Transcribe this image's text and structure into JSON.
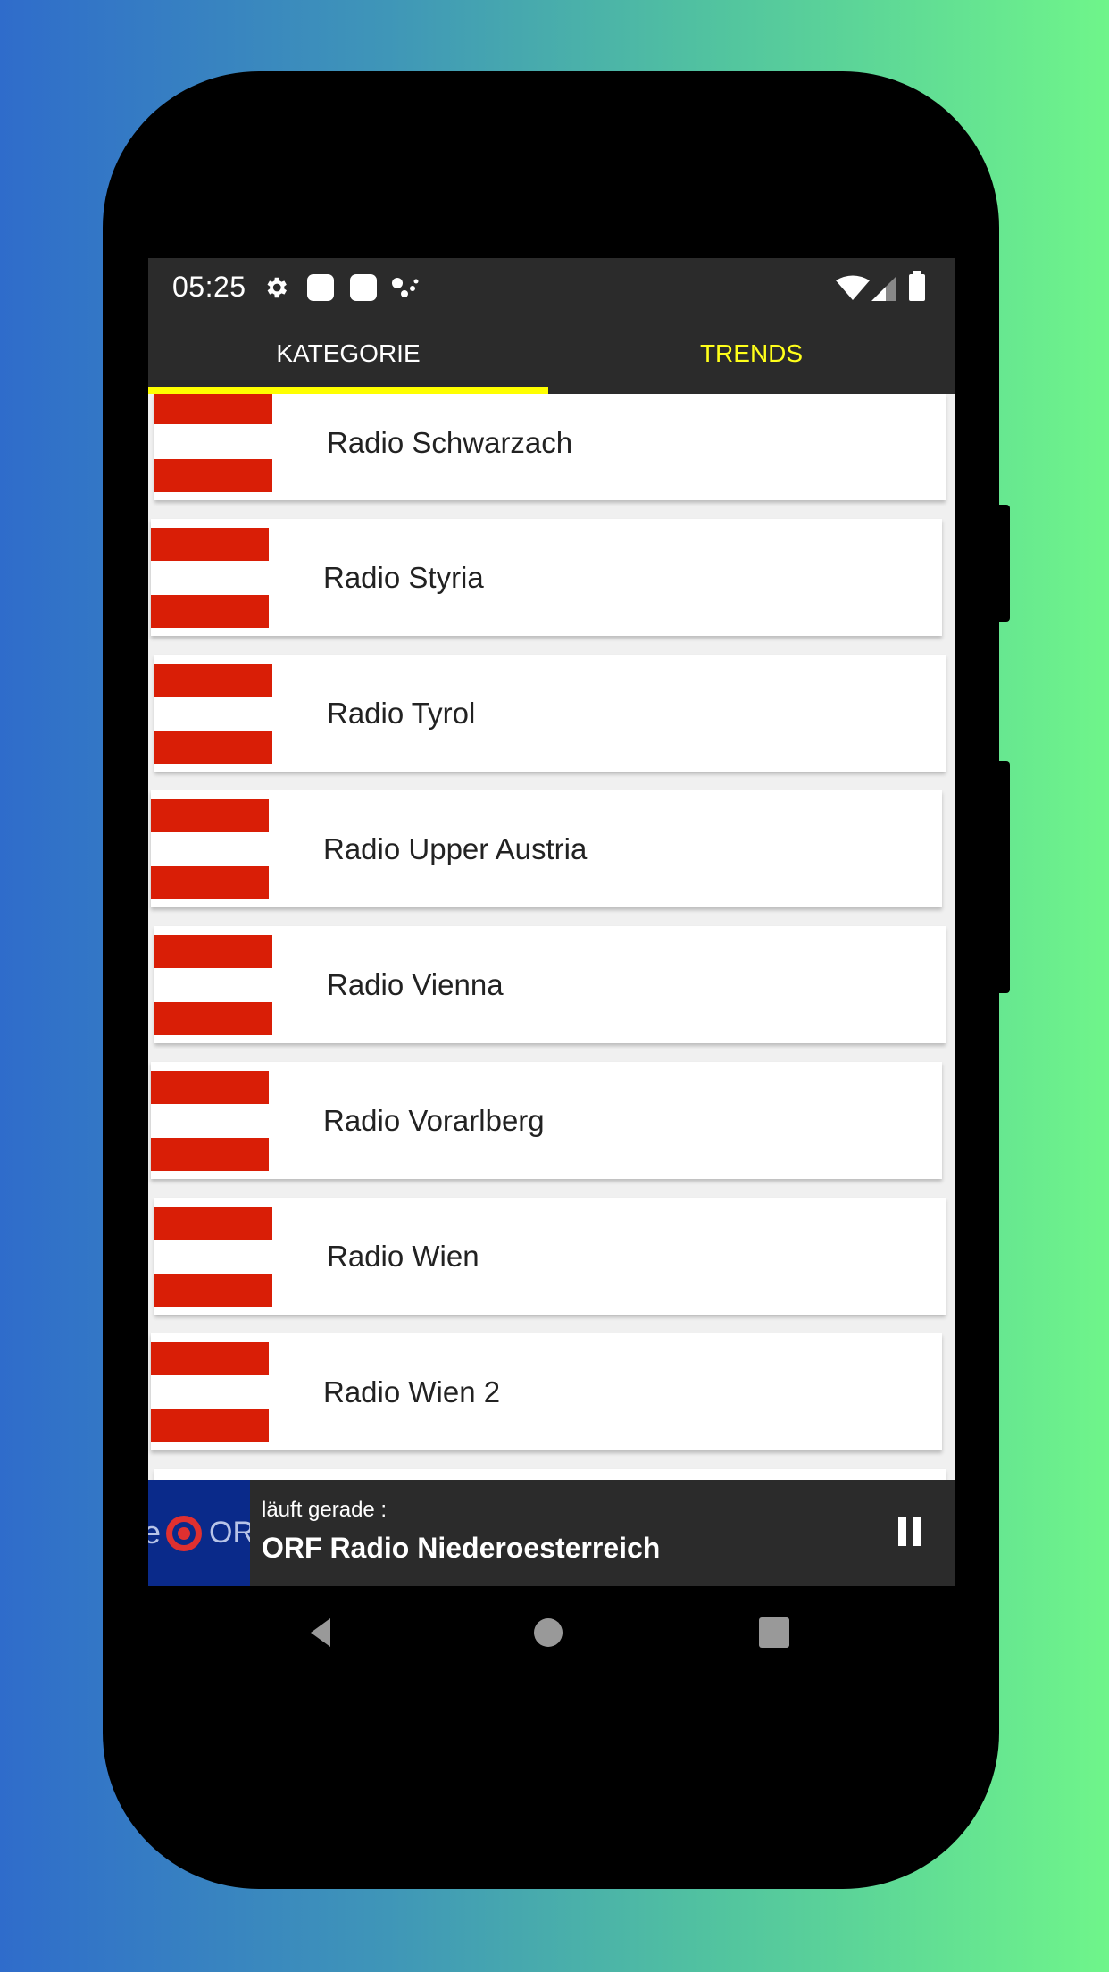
{
  "status_bar": {
    "time": "05:25",
    "left_icons": [
      "settings-gear-icon",
      "notification-app-icon",
      "notification-app-icon",
      "assistant-dots-icon"
    ],
    "right_icons": [
      "wifi-icon",
      "cellular-signal-icon",
      "battery-icon"
    ]
  },
  "tabs": [
    {
      "label": "KATEGORIE",
      "active": true
    },
    {
      "label": "TRENDS",
      "active": false
    }
  ],
  "colors": {
    "tab_indicator": "#ffff00",
    "trends_tab_text": "#ffff1a",
    "bar_background": "#2b2b2b",
    "flag_red": "#d91e06",
    "logo_blue": "#0a2a8a"
  },
  "stations": [
    {
      "name": "Radio Schwarzach",
      "icon": "austria-flag-icon"
    },
    {
      "name": "Radio Styria",
      "icon": "austria-flag-icon"
    },
    {
      "name": "Radio Tyrol",
      "icon": "austria-flag-icon"
    },
    {
      "name": "Radio Upper Austria",
      "icon": "austria-flag-icon"
    },
    {
      "name": "Radio Vienna",
      "icon": "austria-flag-icon"
    },
    {
      "name": "Radio Vorarlberg",
      "icon": "austria-flag-icon"
    },
    {
      "name": "Radio Wien",
      "icon": "austria-flag-icon"
    },
    {
      "name": "Radio Wien 2",
      "icon": "austria-flag-icon"
    }
  ],
  "player": {
    "label": "läuft gerade :",
    "title": "ORF Radio Niederoesterreich",
    "logo_text": "ORF",
    "logo_prefix": "e",
    "control": "pause-icon"
  },
  "nav_bar": [
    "back-icon",
    "home-icon",
    "recents-icon"
  ]
}
